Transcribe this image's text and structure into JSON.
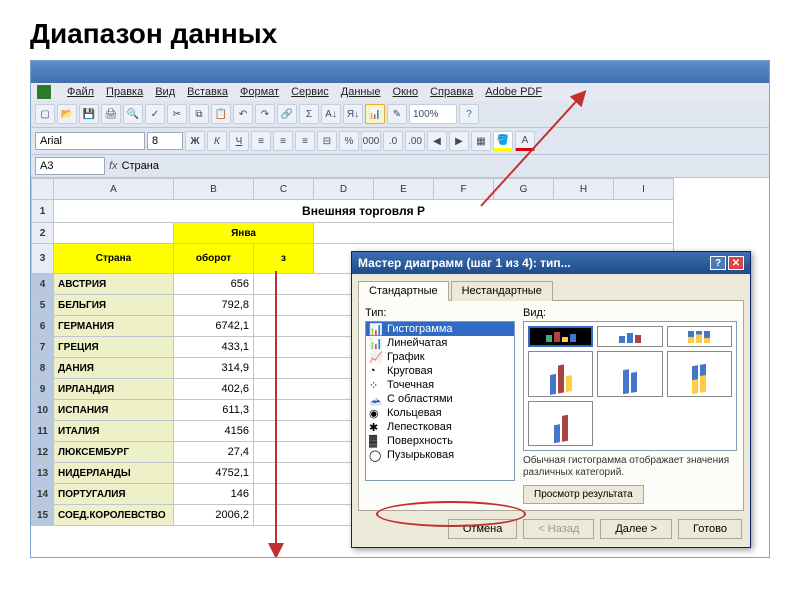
{
  "slide": {
    "title": "Диапазон данных"
  },
  "menu": {
    "file": "Файл",
    "edit": "Правка",
    "view": "Вид",
    "insert": "Вставка",
    "format": "Формат",
    "tools": "Сервис",
    "data": "Данные",
    "window": "Окно",
    "help": "Справка",
    "adobe": "Adobe PDF"
  },
  "toolbar": {
    "zoom": "100%"
  },
  "format": {
    "font": "Arial",
    "size": "8",
    "bold": "Ж",
    "italic": "К",
    "underline": "Ч"
  },
  "namebox": {
    "ref": "A3",
    "fx": "fx",
    "formula": "Страна"
  },
  "columns": [
    "A",
    "B",
    "C",
    "D",
    "E",
    "F",
    "G",
    "H",
    "I"
  ],
  "sheet": {
    "title": "Внешняя торговля Р",
    "month": "Янва",
    "hdr_country": "Страна",
    "hdr_turnover": "оборот",
    "hdr_z": "з",
    "rows": [
      {
        "n": "4",
        "country": "АВСТРИЯ",
        "val": "656"
      },
      {
        "n": "5",
        "country": "БЕЛЬГИЯ",
        "val": "792,8"
      },
      {
        "n": "6",
        "country": "ГЕРМАНИЯ",
        "val": "6742,1"
      },
      {
        "n": "7",
        "country": "ГРЕЦИЯ",
        "val": "433,1"
      },
      {
        "n": "8",
        "country": "ДАНИЯ",
        "val": "314,9"
      },
      {
        "n": "9",
        "country": "ИРЛАНДИЯ",
        "val": "402,6"
      },
      {
        "n": "10",
        "country": "ИСПАНИЯ",
        "val": "611,3"
      },
      {
        "n": "11",
        "country": "ИТАЛИЯ",
        "val": "4156"
      },
      {
        "n": "12",
        "country": "ЛЮКСЕМБУРГ",
        "val": "27,4"
      },
      {
        "n": "13",
        "country": "НИДЕРЛАНДЫ",
        "val": "4752,1"
      },
      {
        "n": "14",
        "country": "ПОРТУГАЛИЯ",
        "val": "146"
      },
      {
        "n": "15",
        "country": "СОЕД.КОРОЛЕВСТВО",
        "val": "2006,2"
      }
    ]
  },
  "dialog": {
    "title": "Мастер диаграмм (шаг 1 из 4): тип...",
    "tab_std": "Стандартные",
    "tab_custom": "Нестандартные",
    "lbl_type": "Тип:",
    "lbl_view": "Вид:",
    "types": [
      "Гистограмма",
      "Линейчатая",
      "График",
      "Круговая",
      "Точечная",
      "С областями",
      "Кольцевая",
      "Лепестковая",
      "Поверхность",
      "Пузырьковая"
    ],
    "desc": "Обычная гистограмма отображает значения различных категорий.",
    "preview": "Просмотр результата",
    "btn_cancel": "Отмена",
    "btn_back": "< Назад",
    "btn_next": "Далее >",
    "btn_finish": "Готово"
  }
}
